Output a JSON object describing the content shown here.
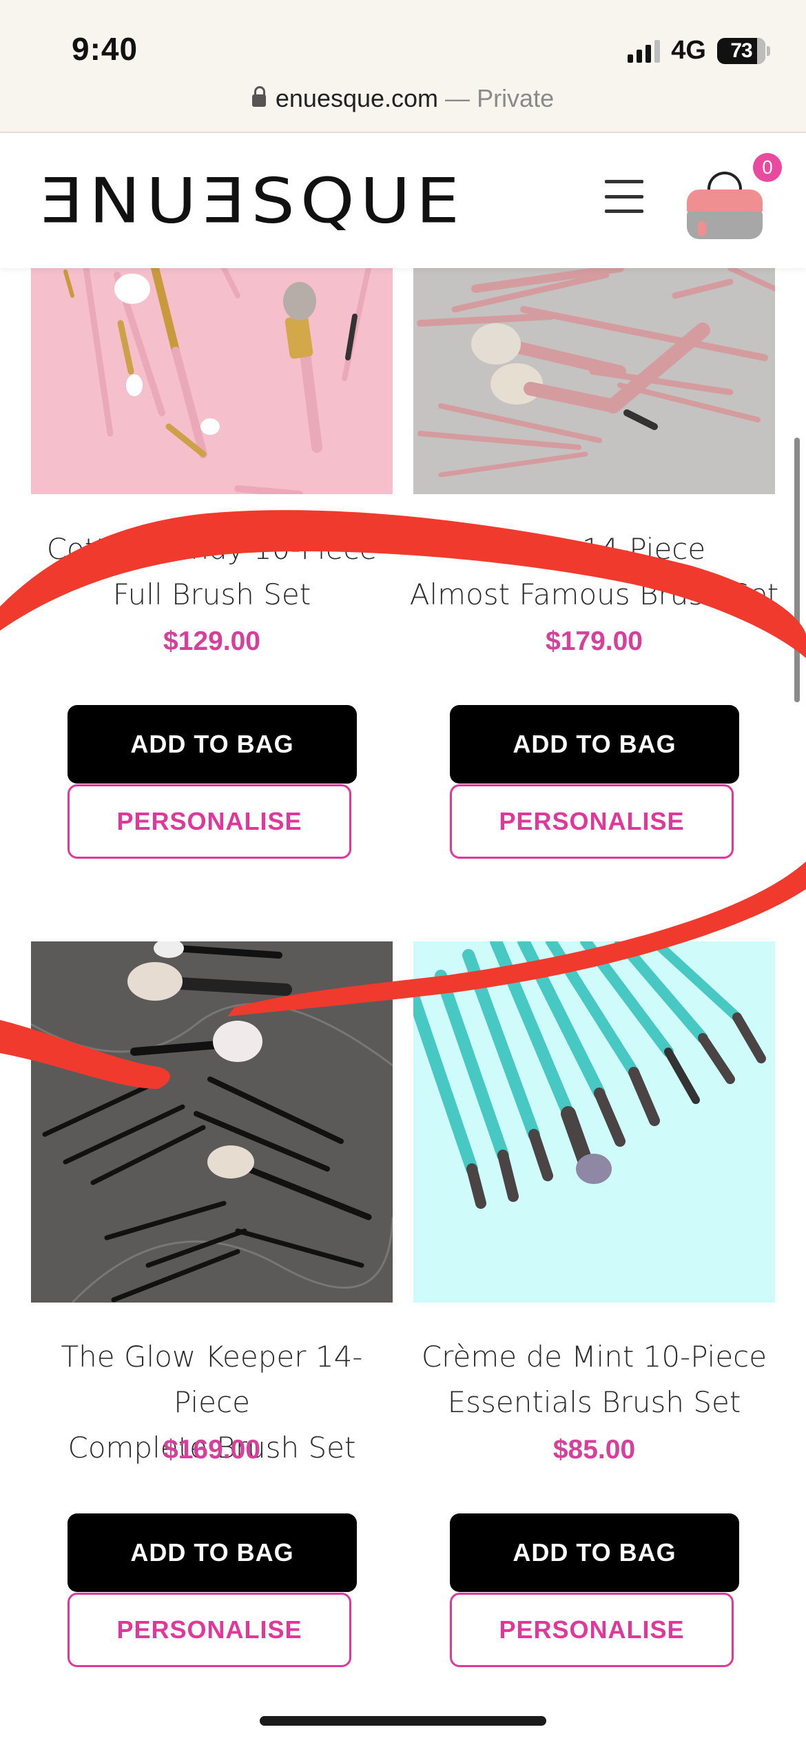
{
  "status_bar": {
    "time": "9:40",
    "network": "4G",
    "battery": "73"
  },
  "url_bar": {
    "domain": "enuesque.com",
    "separator": " — ",
    "mode": "Private"
  },
  "header": {
    "logo": "ƎNUƎSQUE",
    "cart_count": "0"
  },
  "products": [
    {
      "name_line1": "Cotton Candy 10-Piece",
      "name_line2": "Full Brush Set",
      "price": "$129.00",
      "add_label": "ADD TO BAG",
      "personalise_label": "PERSONALISE"
    },
    {
      "name_line1": "Rouge 14-Piece",
      "name_line2": "Almost Famous Brush Set",
      "price": "$179.00",
      "add_label": "ADD TO BAG",
      "personalise_label": "PERSONALISE"
    },
    {
      "name_line1": "The Glow Keeper 14-Piece",
      "name_line2": "Complete Brush Set",
      "price": "$169.00",
      "add_label": "ADD TO BAG",
      "personalise_label": "PERSONALISE"
    },
    {
      "name_line1": "Crème de Mint 10-Piece",
      "name_line2": "Essentials Brush Set",
      "price": "$85.00",
      "add_label": "ADD TO BAG",
      "personalise_label": "PERSONALISE"
    }
  ],
  "colors": {
    "accent": "#e0389a",
    "price": "#d6409a",
    "button": "#000000",
    "scribble": "#f03a2e"
  }
}
